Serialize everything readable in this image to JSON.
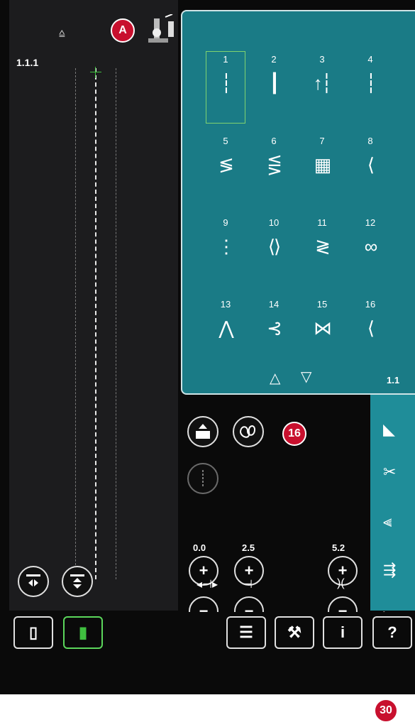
{
  "preview": {
    "label": "1.1.1"
  },
  "callouts": {
    "a": "A",
    "sixteen": "16",
    "thirty": "30"
  },
  "stitches": [
    {
      "num": "1",
      "glyph": "┆"
    },
    {
      "num": "2",
      "glyph": "┃"
    },
    {
      "num": "3",
      "glyph": "↑┆"
    },
    {
      "num": "4",
      "glyph": "┆"
    },
    {
      "num": "5",
      "glyph": "≶"
    },
    {
      "num": "6",
      "glyph": "⋚"
    },
    {
      "num": "7",
      "glyph": "▦"
    },
    {
      "num": "8",
      "glyph": "⟨"
    },
    {
      "num": "9",
      "glyph": "⋮"
    },
    {
      "num": "10",
      "glyph": "⟨⟩"
    },
    {
      "num": "11",
      "glyph": "≷"
    },
    {
      "num": "12",
      "glyph": "∞"
    },
    {
      "num": "13",
      "glyph": "⋀"
    },
    {
      "num": "14",
      "glyph": "⊰"
    },
    {
      "num": "15",
      "glyph": "⋈"
    },
    {
      "num": "16",
      "glyph": "⟨"
    }
  ],
  "panel": {
    "page": "1.1",
    "arrow_up": "△",
    "arrow_down": "▽"
  },
  "values": {
    "stitch_position": "0.0",
    "stitch_length": "2.5",
    "stitch_width": "5.2"
  },
  "icons": {
    "foot": "foot-icon",
    "presser_foot": "presser-foot-icon",
    "load": "load-icon",
    "stitch_options": "stitch-options-icon",
    "tapering": "tapering-icon"
  }
}
